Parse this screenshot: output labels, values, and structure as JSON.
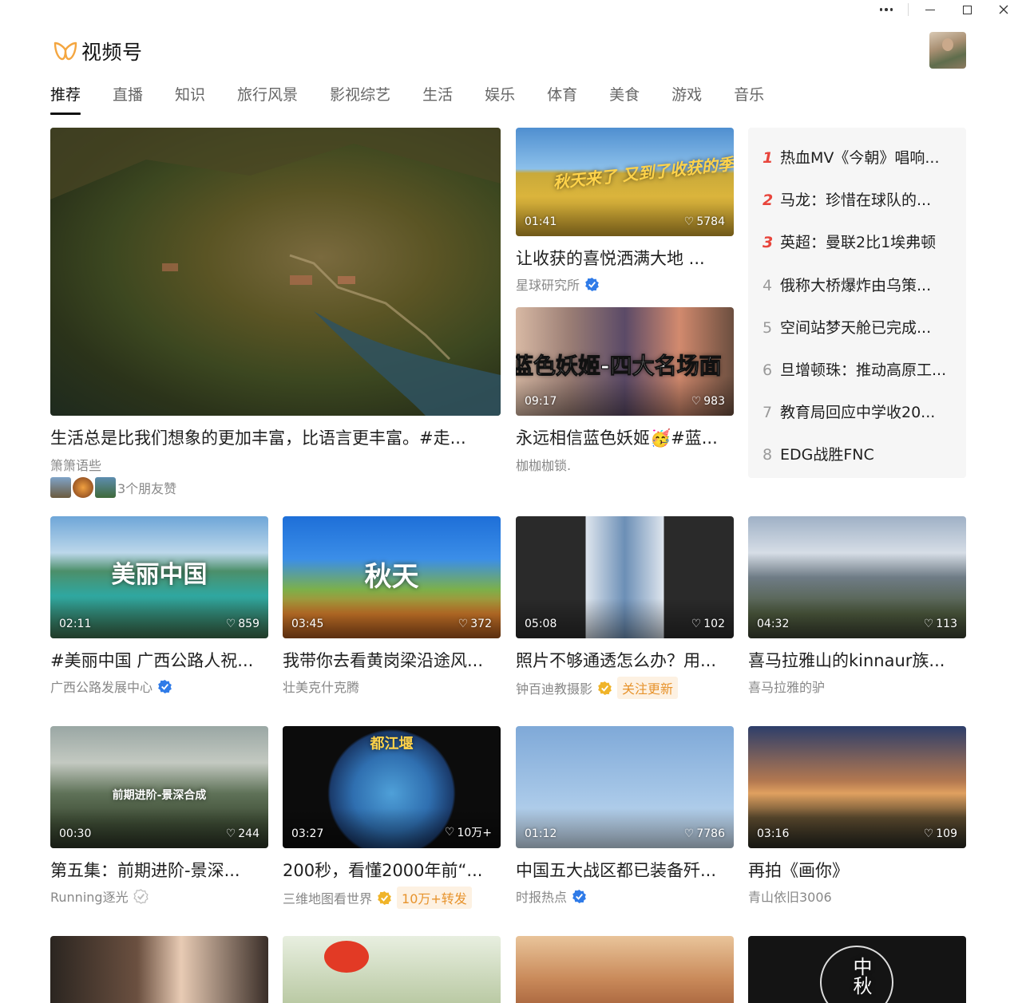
{
  "app": {
    "name": "视频号"
  },
  "window": {
    "more": "•••",
    "minimize": "minimize",
    "maximize": "maximize",
    "close": "close"
  },
  "tabs": [
    "推荐",
    "直播",
    "知识",
    "旅行风景",
    "影视综艺",
    "生活",
    "娱乐",
    "体育",
    "美食",
    "游戏",
    "音乐"
  ],
  "featured": {
    "title": "生活总是比我们想象的更加丰富，比语言更丰富。#走...",
    "author": "箫箫语些",
    "friends_liked": "3个朋友赞"
  },
  "side_videos": [
    {
      "duration": "01:41",
      "likes": "5784",
      "title": "让收获的喜悦洒满大地 ...",
      "author": "星球研究所",
      "verified": true,
      "overlay": "秋天来了 又到了收获的季节"
    },
    {
      "duration": "09:17",
      "likes": "983",
      "title": "永远相信蓝色妖姬🥳#蓝...",
      "author": "枷枷枷锁.",
      "verified": false,
      "overlay": "蓝色妖姬-四大名场面"
    }
  ],
  "hot_list": [
    {
      "rank": "1",
      "text": "热血MV《今朝》唱响..."
    },
    {
      "rank": "2",
      "text": "马龙：珍惜在球队的..."
    },
    {
      "rank": "3",
      "text": "英超：曼联2比1埃弗顿"
    },
    {
      "rank": "4",
      "text": "俄称大桥爆炸由乌策..."
    },
    {
      "rank": "5",
      "text": "空间站梦天舱已完成..."
    },
    {
      "rank": "6",
      "text": "旦增顿珠：推动高原工..."
    },
    {
      "rank": "7",
      "text": "教育局回应中学收20..."
    },
    {
      "rank": "8",
      "text": "EDG战胜FNC"
    }
  ],
  "row2": [
    {
      "duration": "02:11",
      "likes": "859",
      "title": "#美丽中国 广西公路人祝...",
      "author": "广西公路发展中心",
      "verified": "blue",
      "badge": "",
      "overlay": "美丽中国"
    },
    {
      "duration": "03:45",
      "likes": "372",
      "title": "我带你去看黄岗梁沿途风...",
      "author": "壮美克什克腾",
      "verified": "",
      "badge": "",
      "overlay": "秋天"
    },
    {
      "duration": "05:08",
      "likes": "102",
      "title": "照片不够通透怎么办？用...",
      "author": "钟百迪教摄影",
      "verified": "gold",
      "badge": "关注更新",
      "overlay": ""
    },
    {
      "duration": "04:32",
      "likes": "113",
      "title": "喜马拉雅山的kinnaur族...",
      "author": "喜马拉雅的驴",
      "verified": "",
      "badge": "",
      "overlay": ""
    }
  ],
  "row3": [
    {
      "duration": "00:30",
      "likes": "244",
      "title": "第五集：前期进阶-景深...",
      "author": "Running逐光",
      "verified": "grey",
      "badge": "",
      "overlay": "前期进阶-景深合成"
    },
    {
      "duration": "03:27",
      "likes": "10万+",
      "title": "200秒，看懂2000年前“...",
      "author": "三维地图看世界",
      "verified": "gold",
      "badge": "10万+转发",
      "overlay": "都江堰"
    },
    {
      "duration": "01:12",
      "likes": "7786",
      "title": "中国五大战区都已装备歼...",
      "author": "时报热点",
      "verified": "blue",
      "badge": "",
      "overlay": ""
    },
    {
      "duration": "03:16",
      "likes": "109",
      "title": "再拍《画你》",
      "author": "青山依旧3006",
      "verified": "",
      "badge": "",
      "overlay": ""
    }
  ],
  "row4_overlay": "中秋",
  "colors": {
    "hot_rank": "#e8453c",
    "verified_blue": "#2f7be8",
    "verified_gold": "#f0b429",
    "badge_bg": "#fdf1e2",
    "badge_text": "#e7932c"
  }
}
